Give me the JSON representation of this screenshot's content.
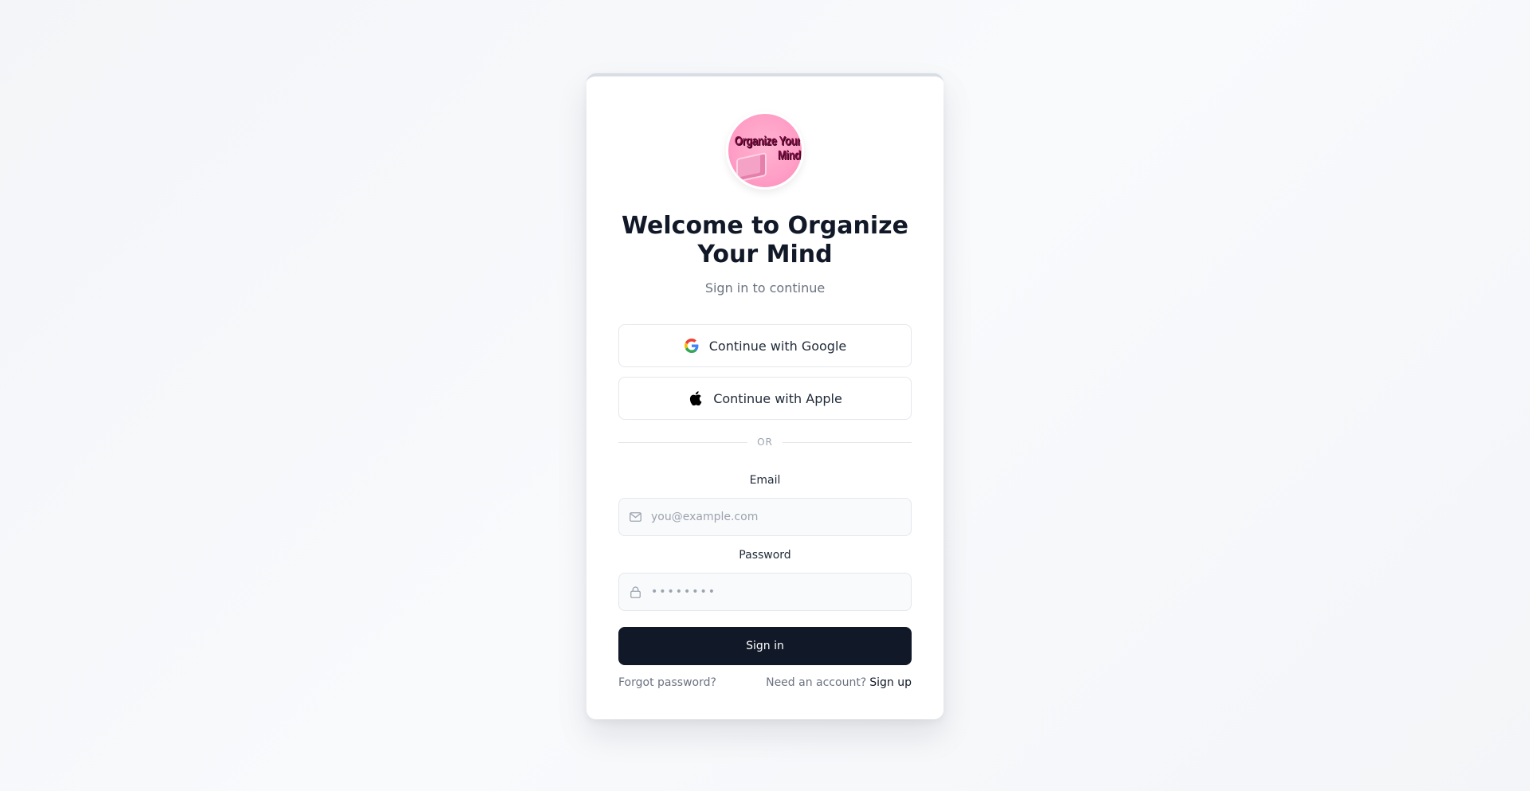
{
  "logo": {
    "text": "Organize Your Mind"
  },
  "header": {
    "title": "Welcome to Organize Your Mind",
    "subtitle": "Sign in to continue"
  },
  "oauth": {
    "google_label": "Continue with Google",
    "apple_label": "Continue with Apple",
    "google_icon": "google-icon",
    "apple_icon": "apple-icon"
  },
  "divider": {
    "text": "OR"
  },
  "form": {
    "email_label": "Email",
    "email_placeholder": "you@example.com",
    "email_icon": "mail-icon",
    "password_label": "Password",
    "password_placeholder": "••••••••",
    "password_icon": "lock-icon",
    "submit_label": "Sign in"
  },
  "footer": {
    "forgot_label": "Forgot password?",
    "need_account_text": "Need an account?",
    "signup_label": "Sign up"
  },
  "colors": {
    "primary": "#111827",
    "muted": "#6b7280",
    "logo_pink": "#ff9ec6"
  }
}
